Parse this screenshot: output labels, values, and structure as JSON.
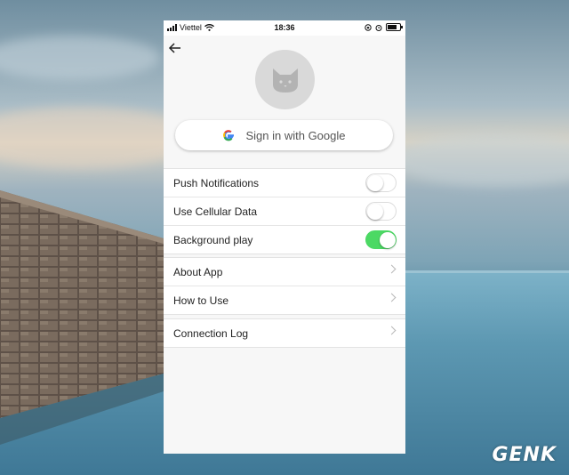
{
  "status_bar": {
    "carrier": "Viettel",
    "time": "18:36",
    "battery_level": 0.8
  },
  "profile": {
    "avatar_icon": "cat-face-icon",
    "back_icon": "arrow-left-icon"
  },
  "signin": {
    "label": "Sign in with Google",
    "icon": "google-g-icon"
  },
  "settings": {
    "toggles": [
      {
        "label": "Push Notifications",
        "on": false
      },
      {
        "label": "Use Cellular Data",
        "on": false
      },
      {
        "label": "Background play",
        "on": true
      }
    ],
    "links": [
      {
        "label": "About App"
      },
      {
        "label": "How to Use"
      }
    ],
    "log": [
      {
        "label": "Connection Log"
      }
    ]
  },
  "colors": {
    "toggle_on": "#4cd964",
    "avatar_bg": "#d9d9d9"
  },
  "watermark": "GENK"
}
